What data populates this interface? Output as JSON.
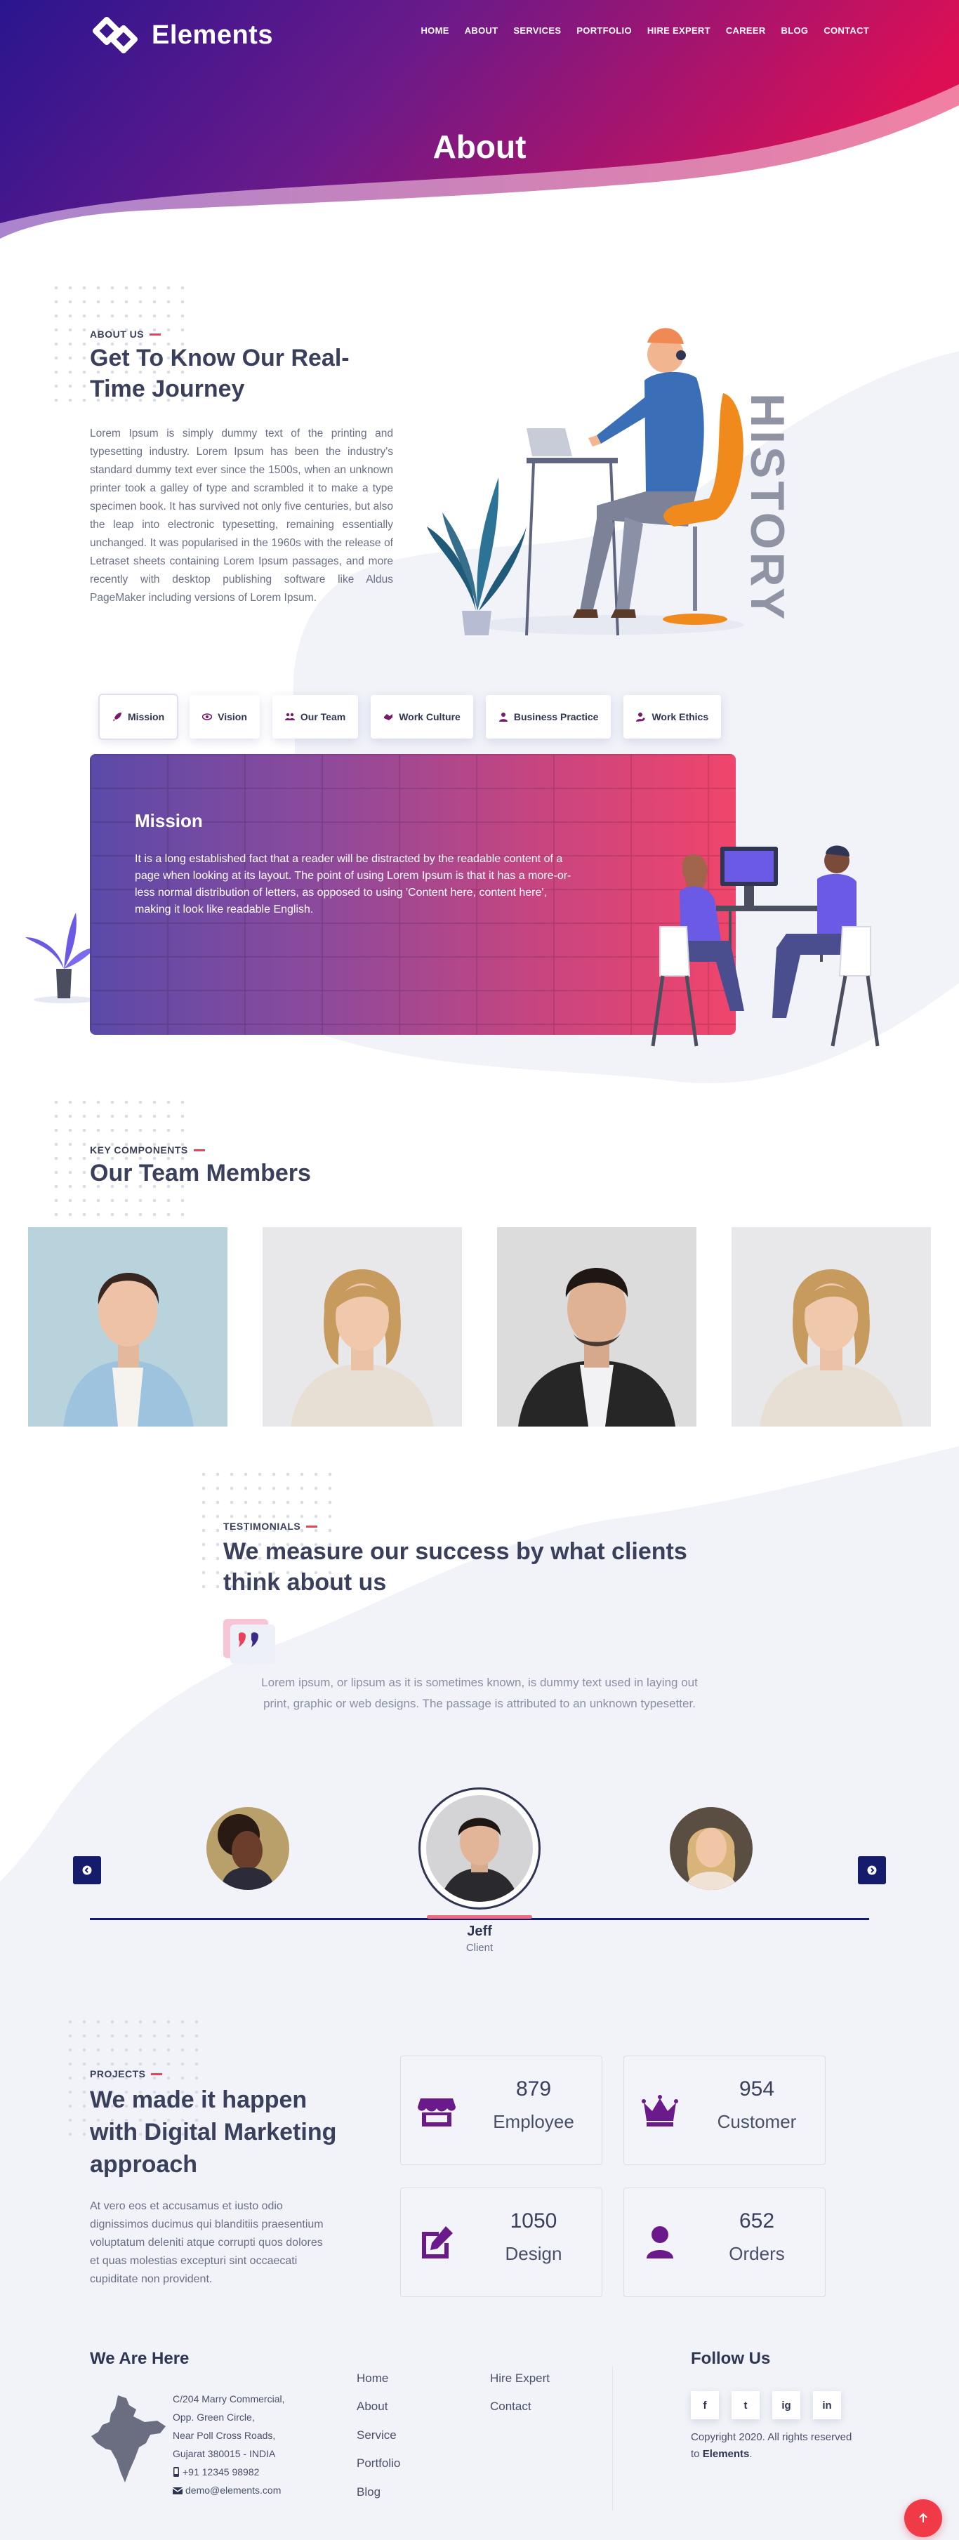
{
  "brand": {
    "name": "Elements"
  },
  "nav": [
    "HOME",
    "ABOUT",
    "SERVICES",
    "PORTFOLIO",
    "HIRE EXPERT",
    "CAREER",
    "BLOG",
    "CONTACT"
  ],
  "hero": {
    "title": "About"
  },
  "about": {
    "label": "ABOUT US",
    "title": "Get To Know Our Real-Time Journey",
    "text": "Lorem Ipsum is simply dummy text of the printing and typesetting industry. Lorem Ipsum has been the industry's standard dummy text ever since the 1500s, when an unknown printer took a galley of type and scrambled it to make a type specimen book. It has survived not only five centuries, but also the leap into electronic typesetting, remaining essentially unchanged. It was popularised in the 1960s with the release of Letraset sheets containing Lorem Ipsum passages, and more recently with desktop publishing software like Aldus PageMaker including versions of Lorem Ipsum.",
    "side_word": "HISTORY"
  },
  "tabs": [
    {
      "label": "Mission",
      "icon": "rocket-icon"
    },
    {
      "label": "Vision",
      "icon": "eye-icon"
    },
    {
      "label": "Our Team",
      "icon": "users-icon"
    },
    {
      "label": "Work Culture",
      "icon": "handshake-icon"
    },
    {
      "label": "Business Practice",
      "icon": "user-tie-icon"
    },
    {
      "label": "Work Ethics",
      "icon": "user-edit-icon"
    }
  ],
  "mission": {
    "title": "Mission",
    "text": "It is a long established fact that a reader will be distracted by the readable content of a page when looking at its layout. The point of using Lorem Ipsum is that it has a more-or-less normal distribution of letters, as opposed to using 'Content here, content here', making it look like readable English."
  },
  "team": {
    "label": "KEY COMPONENTS",
    "title": "Our Team Members"
  },
  "testimonials": {
    "label": "TESTIMONIALS",
    "title": "We measure our success by what clients think about us",
    "text": "Lorem ipsum, or lipsum as it is sometimes known, is dummy text used in laying out print, graphic or web designs. The passage is attributed to an unknown typesetter.",
    "client_name": "Jeff",
    "client_role": "Client"
  },
  "projects": {
    "label": "PROJECTS",
    "title": "We made it happen with Digital Marketing approach",
    "text": "At vero eos et accusamus et iusto odio dignissimos ducimus qui blanditiis praesentium voluptatum deleniti atque corrupti quos dolores et quas molestias excepturi sint occaecati cupiditate non provident.",
    "stats": [
      {
        "value": "879",
        "label": "Employee",
        "icon": "store-icon"
      },
      {
        "value": "954",
        "label": "Customer",
        "icon": "crown-icon"
      },
      {
        "value": "1050",
        "label": "Design",
        "icon": "edit-icon"
      },
      {
        "value": "652",
        "label": "Orders",
        "icon": "user-icon"
      }
    ]
  },
  "footer": {
    "here_title": "We Are Here",
    "address": [
      "C/204 Marry Commercial,",
      "Opp. Green Circle,",
      "Near Poll Cross Roads,",
      "Gujarat 380015 - INDIA",
      "+91 12345 98982",
      "demo@elements.com"
    ],
    "links_col1": [
      "Home",
      "About",
      "Service",
      "Portfolio",
      "Blog"
    ],
    "links_col2": [
      "Hire Expert",
      "Contact"
    ],
    "follow_title": "Follow Us",
    "social": [
      "f",
      "t",
      "ig",
      "in"
    ],
    "copyright_prefix": "Copyright 2020. All rights reserved to",
    "copyright_brand": "Elements",
    "copyright_suffix": "."
  },
  "colors": {
    "accent": "#e8435a",
    "navy": "#141c6b",
    "hero_start": "#3b1aa0",
    "hero_end": "#d8125a"
  }
}
